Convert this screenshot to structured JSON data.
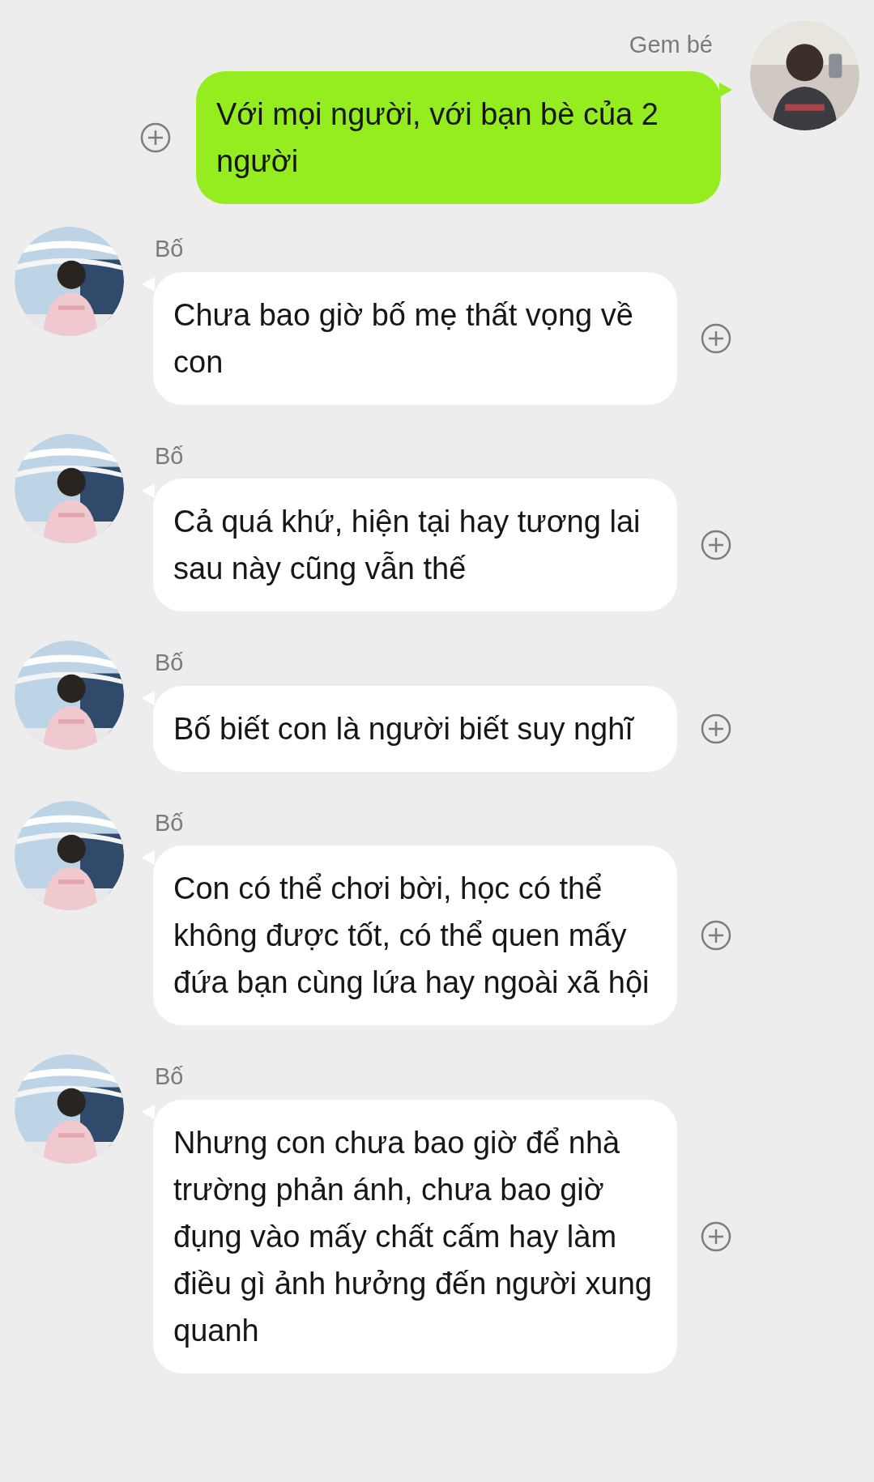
{
  "messages": [
    {
      "kind": "outgoing",
      "sender": "Gem bé",
      "text": "Với mọi người, với bạn bè của 2 người"
    },
    {
      "kind": "incoming",
      "sender": "Bố",
      "text": "Chưa bao giờ bố mẹ thất vọng về con"
    },
    {
      "kind": "incoming",
      "sender": "Bố",
      "text": "Cả quá khứ, hiện tại hay tương lai sau này cũng vẫn thế"
    },
    {
      "kind": "incoming",
      "sender": "Bố",
      "text": "Bố biết con là người biết suy nghĩ"
    },
    {
      "kind": "incoming",
      "sender": "Bố",
      "text": "Con có thể chơi bời, học có thể không được tốt, có thể quen mấy đứa bạn cùng lứa hay ngoài xã hội"
    },
    {
      "kind": "incoming",
      "sender": "Bố",
      "text": "Nhưng con chưa bao giờ để nhà trường phản ánh, chưa bao giờ đụng vào mấy chất cấm hay làm điều gì ảnh hưởng đến người xung quanh"
    }
  ]
}
